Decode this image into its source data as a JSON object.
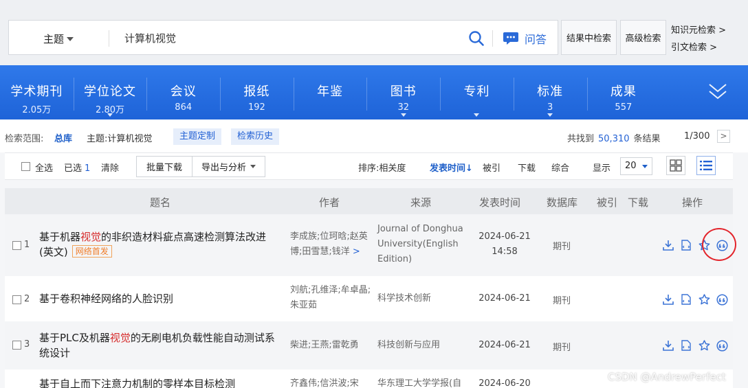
{
  "search": {
    "field": "主题",
    "query": "计算机视觉",
    "qa_label": "问答",
    "result_search": "结果中检索",
    "advanced": "高级检索",
    "knowledge_search": "知识元检索 >",
    "citation_search": "引文检索 >"
  },
  "categories": [
    {
      "name": "学术期刊",
      "count": "2.05万"
    },
    {
      "name": "学位论文",
      "count": "2.80万"
    },
    {
      "name": "会议",
      "count": "864"
    },
    {
      "name": "报纸",
      "count": "192"
    },
    {
      "name": "年鉴",
      "count": ""
    },
    {
      "name": "图书",
      "count": "32"
    },
    {
      "name": "专利",
      "count": ""
    },
    {
      "name": "标准",
      "count": "3"
    },
    {
      "name": "成果",
      "count": "557"
    }
  ],
  "scope": {
    "label": "检索范围:",
    "value": "总库",
    "topic": "主题:计算机视觉",
    "chip_topic": "主题定制",
    "chip_history": "检索历史",
    "found_prefix": "共找到",
    "found_count": "50,310",
    "found_suffix": "条结果",
    "page": "1/300",
    "next": ">"
  },
  "toolbar": {
    "select_all": "全选",
    "selected": "已选",
    "selected_count": "1",
    "clear": "清除",
    "batch_download": "批量下载",
    "export": "导出与分析",
    "sort_label": "排序:",
    "sort_relevance": "相关度",
    "sort_date": "发表时间↓",
    "sort_cite": "被引",
    "sort_download": "下载",
    "sort_all": "综合",
    "show_label": "显示",
    "page_size": "20"
  },
  "table": {
    "headers": {
      "title": "题名",
      "author": "作者",
      "source": "来源",
      "date": "发表时间",
      "db": "数据库",
      "cite": "被引",
      "download": "下载",
      "ops": "操作"
    },
    "rows": [
      {
        "index": "1",
        "title_pre": "基于机器",
        "title_hl": "视觉",
        "title_post": "的非织造材料疵点高速检测算法改进(英文)",
        "badge": "网络首发",
        "authors": "李成族;位珂晗;赵英博;田雪慧;钱洋",
        "author_more": ">",
        "source": "Journal of Donghua University(English Edition)",
        "date": "2024-06-21",
        "time": "14:58",
        "db": "期刊"
      },
      {
        "index": "2",
        "title_pre": "基于卷积神经网络的人脸识别",
        "title_hl": "",
        "title_post": "",
        "badge": "",
        "authors": "刘航;孔维泽;牟卓晶;朱亚茹",
        "author_more": "",
        "source": "科学技术创新",
        "date": "2024-06-21",
        "time": "",
        "db": "期刊"
      },
      {
        "index": "3",
        "title_pre": "基于PLC及机器",
        "title_hl": "视觉",
        "title_post": "的无刷电机负载性能自动测试系统设计",
        "badge": "",
        "authors": "柴进;王燕;雷乾勇",
        "author_more": "",
        "source": "科技创新与应用",
        "date": "2024-06-21",
        "time": "",
        "db": "期刊"
      },
      {
        "index": "4",
        "title_pre": "基于自上而下注意力机制的零样本目标检测",
        "title_hl": "",
        "title_post": "",
        "badge": "",
        "authors": "齐鑫伟;信洪波;宋",
        "author_more": "",
        "source": "华东理工大学学报(自",
        "date": "2024-06-20",
        "time": "",
        "db": ""
      }
    ]
  },
  "watermark": "CSDN @AndrewPerfect",
  "colors": {
    "brand_blue": "#1e63d8",
    "link_blue": "#2361d4",
    "highlight_red": "#d62b2b",
    "badge_orange": "#f07d2a",
    "annotation_red": "#e3242b"
  }
}
